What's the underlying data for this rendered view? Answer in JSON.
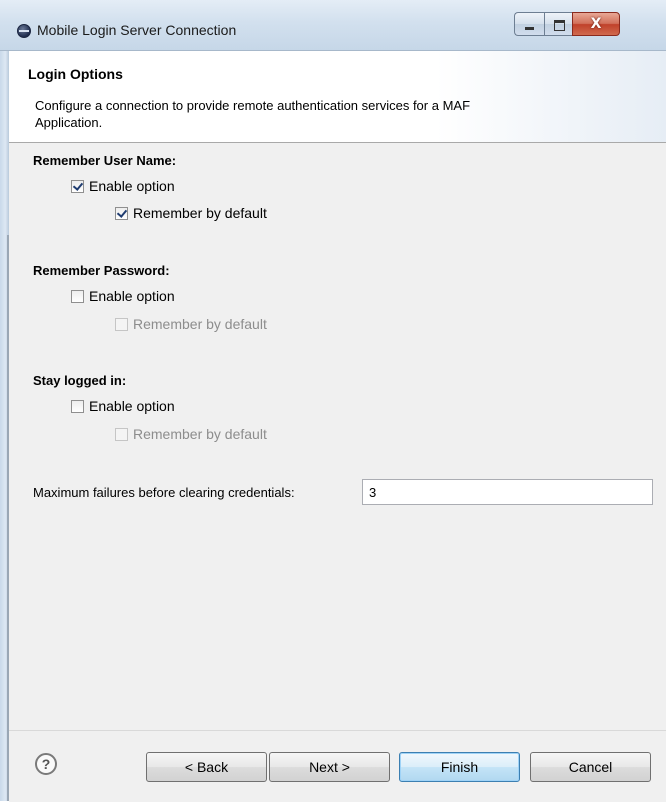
{
  "window": {
    "title": "Mobile Login Server Connection",
    "minimize_icon": "minimize-icon",
    "maximize_icon": "maximize-icon",
    "close_glyph": "X"
  },
  "header": {
    "title": "Login Options",
    "message": "Configure a connection to provide remote authentication services for a MAF Application."
  },
  "sections": {
    "remember_user": {
      "title": "Remember User Name:",
      "enable_label": "Enable option",
      "enable_checked": true,
      "default_label": "Remember by default",
      "default_checked": true,
      "default_disabled": false
    },
    "remember_password": {
      "title": "Remember Password:",
      "enable_label": "Enable option",
      "enable_checked": false,
      "default_label": "Remember by default",
      "default_checked": false,
      "default_disabled": true
    },
    "stay_logged_in": {
      "title": "Stay logged in:",
      "enable_label": "Enable option",
      "enable_checked": false,
      "default_label": "Remember by default",
      "default_checked": false,
      "default_disabled": true
    }
  },
  "max_failures": {
    "label": "Maximum failures before clearing credentials:",
    "value": "3"
  },
  "footer": {
    "help_glyph": "?",
    "back_label": "< Back",
    "next_label": "Next >",
    "finish_label": "Finish",
    "cancel_label": "Cancel"
  },
  "colors": {
    "titlebar": "#d2e0ee",
    "content_bg": "#f0f0f0",
    "close_button": "#c0412a",
    "default_button_border": "#3c7fb1"
  }
}
